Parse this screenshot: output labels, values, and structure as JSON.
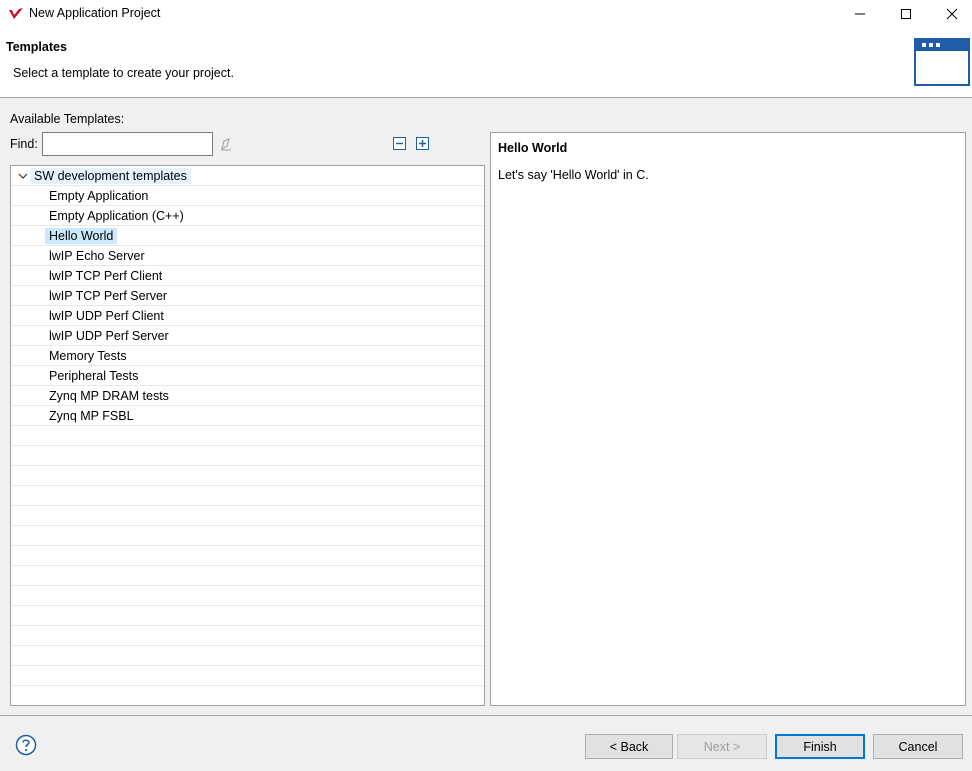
{
  "window": {
    "title": "New Application Project"
  },
  "header": {
    "title": "Templates",
    "description": "Select a template to create your project."
  },
  "templates": {
    "available_label": "Available Templates:",
    "find_label": "Find:",
    "find_value": "",
    "category": "SW development templates",
    "items": [
      "Empty Application",
      "Empty Application (C++)",
      "Hello World",
      "lwIP Echo Server",
      "lwIP TCP Perf Client",
      "lwIP TCP Perf Server",
      "lwIP UDP Perf Client",
      "lwIP UDP Perf Server",
      "Memory Tests",
      "Peripheral Tests",
      "Zynq MP DRAM tests",
      "Zynq MP FSBL"
    ],
    "selected": "Hello World"
  },
  "description": {
    "title": "Hello World",
    "text": "Let's say 'Hello World' in C."
  },
  "buttons": {
    "back": "< Back",
    "next": "Next >",
    "finish": "Finish",
    "cancel": "Cancel"
  },
  "colors": {
    "selection": "#cce8ff",
    "default_button_border": "#0078d7",
    "header_icon": "#1f5ea8"
  }
}
